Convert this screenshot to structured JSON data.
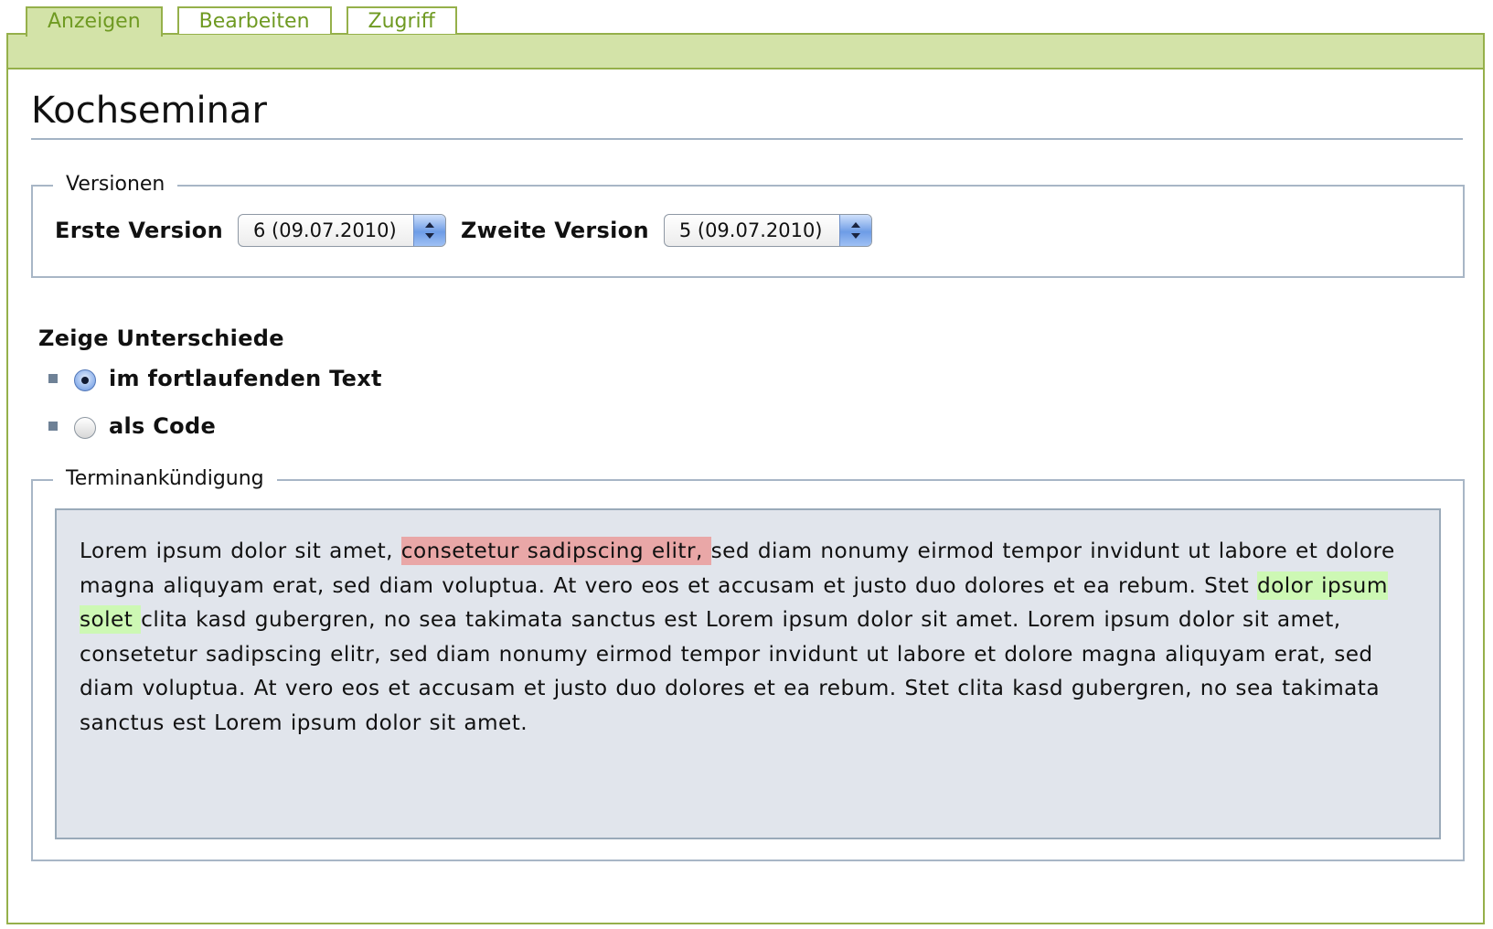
{
  "tabs": [
    {
      "label": "Anzeigen",
      "active": true
    },
    {
      "label": "Bearbeiten",
      "active": false
    },
    {
      "label": "Zugriff",
      "active": false
    }
  ],
  "page": {
    "title": "Kochseminar"
  },
  "versions": {
    "legend": "Versionen",
    "first_label": "Erste Version",
    "first_value": "6 (09.07.2010)",
    "second_label": "Zweite Version",
    "second_value": "5 (09.07.2010)"
  },
  "diff_mode": {
    "title": "Zeige Unterschiede",
    "options": [
      {
        "label": "im fortlaufenden Text",
        "checked": true
      },
      {
        "label": "als Code",
        "checked": false
      }
    ]
  },
  "notice": {
    "legend": "Terminankündigung",
    "text_before": "Lorem ipsum dolor sit amet, ",
    "deleted": "consetetur sadipscing elitr, ",
    "text_middle": "sed diam nonumy eirmod tempor invidunt ut labore et dolore magna aliquyam erat, sed diam voluptua. At vero eos et accusam et justo duo dolores et ea rebum. Stet ",
    "inserted": "dolor ipsum solet ",
    "text_after": "clita kasd gubergren, no sea takimata sanctus est Lorem ipsum dolor sit amet. Lorem ipsum dolor sit amet, consetetur sadipscing elitr, sed diam nonumy eirmod tempor invidunt ut labore et dolore magna aliquyam erat, sed diam voluptua. At vero eos et accusam et justo duo dolores et ea rebum. Stet clita kasd gubergren, no sea takimata sanctus est Lorem ipsum dolor sit amet."
  },
  "colors": {
    "tab_border": "#95b04a",
    "tab_active_bg": "#d3e3a8",
    "tab_text": "#6f9a22",
    "deleted_highlight": "#e9a7a7",
    "inserted_highlight": "#cdf8b4",
    "text_box_bg": "#e1e5ec"
  },
  "icons": {
    "select_arrows": "chevron-updown-icon",
    "bullet": "square-bullet-icon"
  }
}
